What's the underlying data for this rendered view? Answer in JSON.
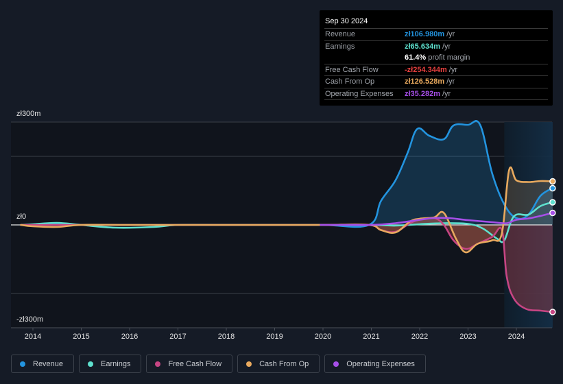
{
  "tooltip": {
    "date": "Sep 30 2024",
    "rows": [
      {
        "label": "Revenue",
        "value": "zł106.980m",
        "unit": "/yr",
        "color": "#2394df"
      },
      {
        "label": "Earnings",
        "value": "zł65.634m",
        "unit": "/yr",
        "color": "#5ee0ce"
      },
      {
        "label": "",
        "value": "61.4%",
        "unit": "profit margin",
        "color": "#ffffff"
      },
      {
        "label": "Free Cash Flow",
        "value": "-zł254.344m",
        "unit": "/yr",
        "color": "#e8403f"
      },
      {
        "label": "Cash From Op",
        "value": "zł126.528m",
        "unit": "/yr",
        "color": "#e8a95e"
      },
      {
        "label": "Operating Expenses",
        "value": "zł35.282m",
        "unit": "/yr",
        "color": "#a64fe8"
      }
    ]
  },
  "axis": {
    "y_labels": [
      "zł300m",
      "zł0",
      "-zł300m"
    ],
    "x_labels": [
      "2014",
      "2015",
      "2016",
      "2017",
      "2018",
      "2019",
      "2020",
      "2021",
      "2022",
      "2023",
      "2024"
    ]
  },
  "legend": [
    {
      "label": "Revenue",
      "color": "#2394df"
    },
    {
      "label": "Earnings",
      "color": "#5ee0ce"
    },
    {
      "label": "Free Cash Flow",
      "color": "#c64583"
    },
    {
      "label": "Cash From Op",
      "color": "#e8a95e"
    },
    {
      "label": "Operating Expenses",
      "color": "#a64fe8"
    }
  ],
  "chart_data": {
    "type": "line",
    "title": "",
    "xlabel": "",
    "ylabel": "",
    "ylim": [
      -300,
      300
    ],
    "xlim": [
      2013.75,
      2024.75
    ],
    "y_unit": "zł m",
    "y_ticks": [
      300,
      0,
      -300
    ],
    "x_ticks": [
      2014,
      2015,
      2016,
      2017,
      2018,
      2019,
      2020,
      2021,
      2022,
      2023,
      2024
    ],
    "highlight_range": [
      2023.75,
      2024.75
    ],
    "grid": true,
    "legend_position": "bottom",
    "series": [
      {
        "name": "Revenue",
        "color": "#2394df",
        "fill": true,
        "x": [
          2013.75,
          2014.0,
          2014.5,
          2015.0,
          2016.0,
          2017.0,
          2018.0,
          2019.0,
          2020.0,
          2020.95,
          2021.2,
          2021.5,
          2021.75,
          2021.95,
          2022.2,
          2022.5,
          2022.7,
          2023.0,
          2023.25,
          2023.5,
          2023.75,
          2024.0,
          2024.25,
          2024.5,
          2024.75
        ],
        "y": [
          0,
          0,
          2,
          0,
          0,
          0,
          0,
          0,
          0,
          0,
          70,
          130,
          210,
          280,
          260,
          250,
          290,
          292,
          292,
          150,
          60,
          20,
          30,
          85,
          107
        ]
      },
      {
        "name": "Earnings",
        "color": "#5ee0ce",
        "fill": false,
        "x": [
          2013.75,
          2014.0,
          2014.5,
          2015.0,
          2015.7,
          2016.5,
          2017.0,
          2018.0,
          2019.0,
          2020.0,
          2021.0,
          2021.5,
          2022.0,
          2022.5,
          2023.0,
          2023.3,
          2023.6,
          2023.75,
          2023.95,
          2024.25,
          2024.5,
          2024.75
        ],
        "y": [
          0,
          2,
          6,
          0,
          -8,
          -6,
          0,
          0,
          0,
          0,
          0,
          -2,
          2,
          5,
          3,
          -10,
          -40,
          -45,
          25,
          30,
          55,
          66
        ]
      },
      {
        "name": "Free Cash Flow",
        "color": "#c64583",
        "fill": true,
        "x": [
          2013.75,
          2014.0,
          2015.0,
          2016.0,
          2017.0,
          2018.0,
          2019.0,
          2020.0,
          2020.95,
          2021.2,
          2021.5,
          2021.8,
          2022.0,
          2022.3,
          2022.5,
          2022.7,
          2022.95,
          2023.2,
          2023.5,
          2023.7,
          2023.8,
          2023.95,
          2024.2,
          2024.5,
          2024.75
        ],
        "y": [
          0,
          0,
          0,
          0,
          0,
          0,
          0,
          0,
          0,
          -15,
          -20,
          5,
          15,
          20,
          0,
          -45,
          -70,
          -55,
          -35,
          -15,
          -150,
          -215,
          -245,
          -250,
          -254
        ]
      },
      {
        "name": "Cash From Op",
        "color": "#e8a95e",
        "fill": true,
        "x": [
          2013.75,
          2014.0,
          2014.5,
          2015.0,
          2016.0,
          2017.0,
          2018.0,
          2019.0,
          2020.0,
          2020.95,
          2021.2,
          2021.5,
          2021.8,
          2022.0,
          2022.3,
          2022.5,
          2022.75,
          2022.95,
          2023.2,
          2023.5,
          2023.7,
          2023.85,
          2024.0,
          2024.25,
          2024.5,
          2024.75
        ],
        "y": [
          0,
          -4,
          -6,
          0,
          0,
          0,
          0,
          0,
          0,
          0,
          -15,
          -22,
          10,
          18,
          22,
          35,
          -40,
          -80,
          -55,
          -45,
          -25,
          160,
          130,
          125,
          128,
          127
        ]
      },
      {
        "name": "Operating Expenses",
        "color": "#a64fe8",
        "fill": false,
        "x": [
          2019.95,
          2020.5,
          2021.0,
          2021.5,
          2022.0,
          2022.3,
          2022.6,
          2023.0,
          2023.5,
          2023.8,
          2024.0,
          2024.3,
          2024.75
        ],
        "y": [
          0,
          0,
          0,
          5,
          15,
          20,
          20,
          14,
          8,
          5,
          15,
          20,
          35
        ]
      }
    ]
  }
}
